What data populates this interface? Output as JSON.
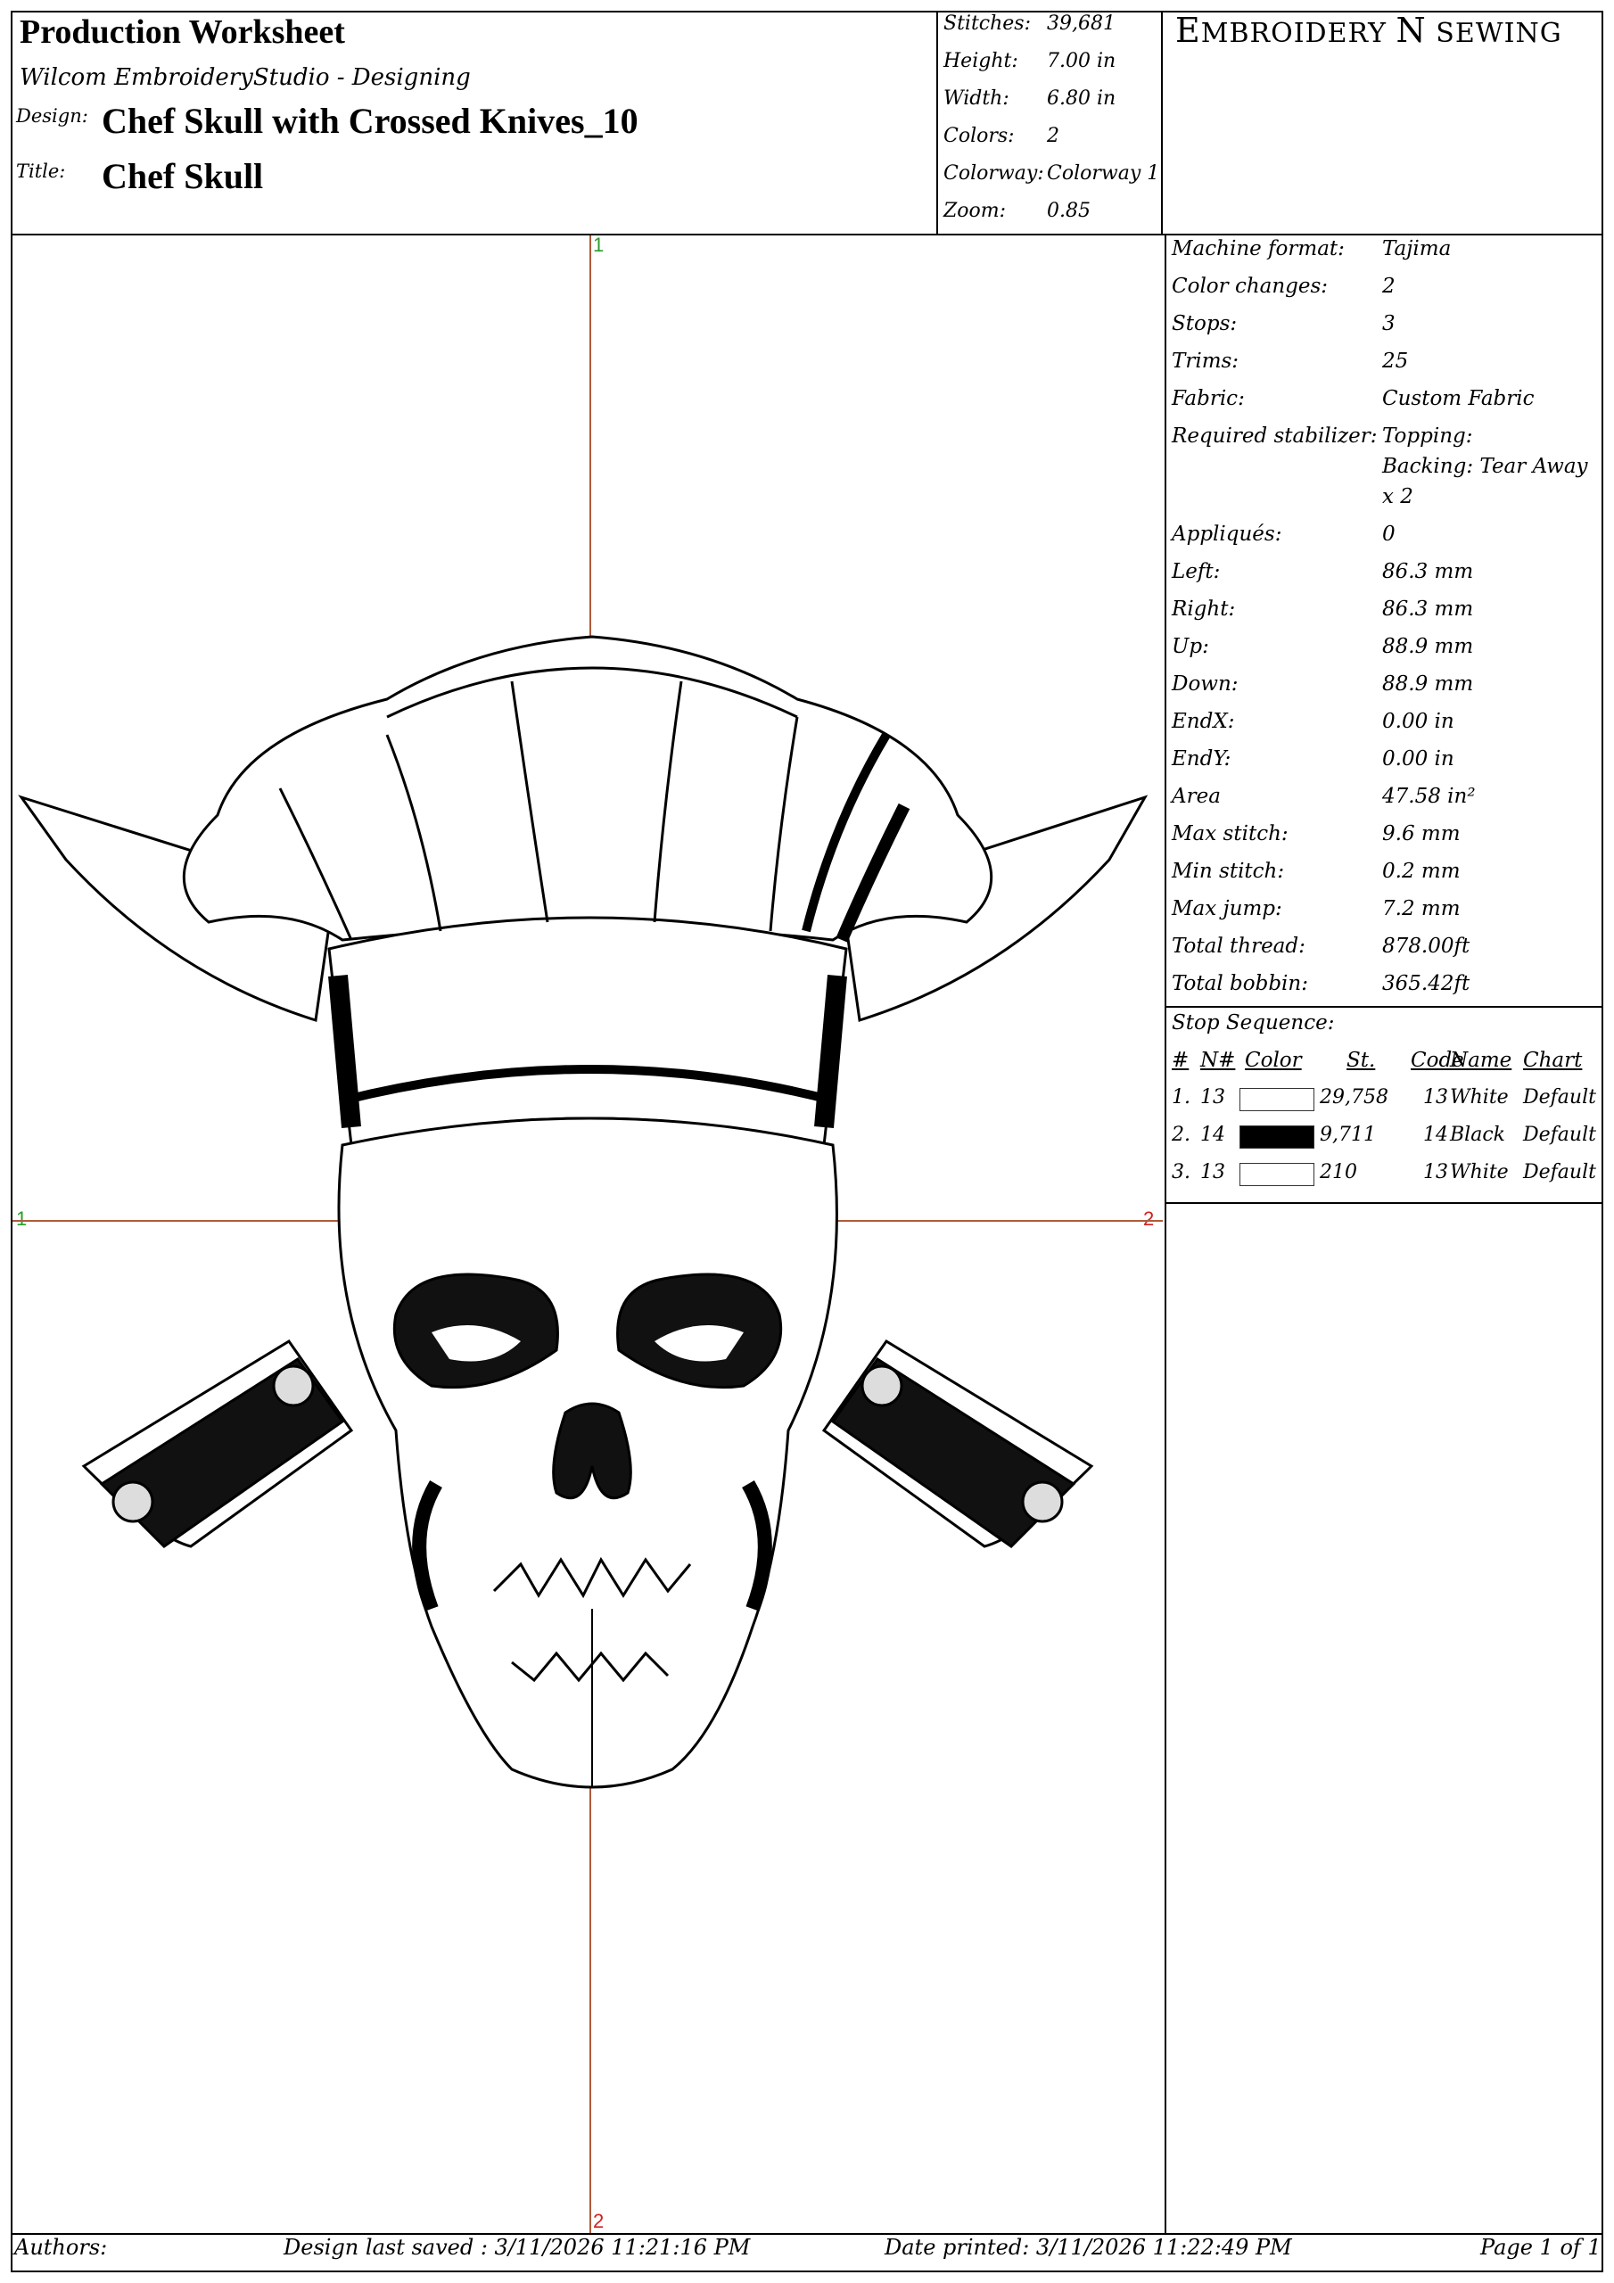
{
  "header": {
    "title": "Production Worksheet",
    "software": "Wilcom EmbroideryStudio - Designing",
    "design_label": "Design:",
    "design_name": "Chef Skull with Crossed Knives_10",
    "title_label": "Title:",
    "title_value": "Chef Skull"
  },
  "stats": [
    {
      "label": "Stitches:",
      "value": "39,681"
    },
    {
      "label": "Height:",
      "value": "7.00  in"
    },
    {
      "label": "Width:",
      "value": "6.80  in"
    },
    {
      "label": "Colors:",
      "value": "2"
    },
    {
      "label": "Colorway:",
      "value": "Colorway 1"
    },
    {
      "label": "Zoom:",
      "value": "0.85"
    }
  ],
  "brand": {
    "first": "E",
    "rest1": "MBROIDERY ",
    "n": "N",
    "y": " S",
    "rest2": "EWING"
  },
  "specs": [
    {
      "label": "Machine format:",
      "value": "Tajima"
    },
    {
      "label": "Color changes:",
      "value": "2"
    },
    {
      "label": "Stops:",
      "value": "3"
    },
    {
      "label": "Trims:",
      "value": "25"
    },
    {
      "label": "Fabric:",
      "value": "Custom Fabric"
    },
    {
      "label": "Required stabilizer:",
      "value": "Topping:"
    },
    {
      "label": "",
      "value": "Backing: Tear Away"
    },
    {
      "label": "",
      "value": "x 2"
    },
    {
      "label": "Appliqués:",
      "value": "0"
    },
    {
      "label": "Left:",
      "value": "86.3  mm"
    },
    {
      "label": "Right:",
      "value": "86.3  mm"
    },
    {
      "label": "Up:",
      "value": "88.9  mm"
    },
    {
      "label": "Down:",
      "value": "88.9  mm"
    },
    {
      "label": "EndX:",
      "value": "0.00  in"
    },
    {
      "label": "EndY:",
      "value": "0.00  in"
    },
    {
      "label": "Area",
      "value": "47.58  in²"
    },
    {
      "label": "Max stitch:",
      "value": "9.6  mm"
    },
    {
      "label": "Min stitch:",
      "value": "0.2  mm"
    },
    {
      "label": "Max jump:",
      "value": "7.2  mm"
    },
    {
      "label": "Total thread:",
      "value": "878.00ft"
    },
    {
      "label": "Total bobbin:",
      "value": "365.42ft"
    }
  ],
  "stop_sequence": {
    "title": "Stop Sequence:",
    "columns": [
      "#",
      "N#",
      "Color",
      "St.",
      "Code",
      "Name",
      "Chart"
    ],
    "rows": [
      {
        "num": "1.",
        "n": "13",
        "color": "#ffffff",
        "st": "29,758",
        "code": "13",
        "name": "White",
        "chart": "Default"
      },
      {
        "num": "2.",
        "n": "14",
        "color": "#000000",
        "st": "9,711",
        "code": "14",
        "name": "Black",
        "chart": "Default"
      },
      {
        "num": "3.",
        "n": "13",
        "color": "#ffffff",
        "st": "210",
        "code": "13",
        "name": "White",
        "chart": "Default"
      }
    ]
  },
  "axes": {
    "top": "1",
    "left": "1",
    "right": "2",
    "bottom": "2"
  },
  "footer": {
    "authors": "Authors:",
    "saved": "Design last saved : 3/11/2026 11:21:16 PM",
    "printed": "Date printed: 3/11/2026 11:22:49 PM",
    "page": "Page 1 of 1"
  },
  "colors": {
    "axis_line": "#b05a3a",
    "axis_green": "#2a9d2a",
    "axis_red": "#d02020"
  }
}
